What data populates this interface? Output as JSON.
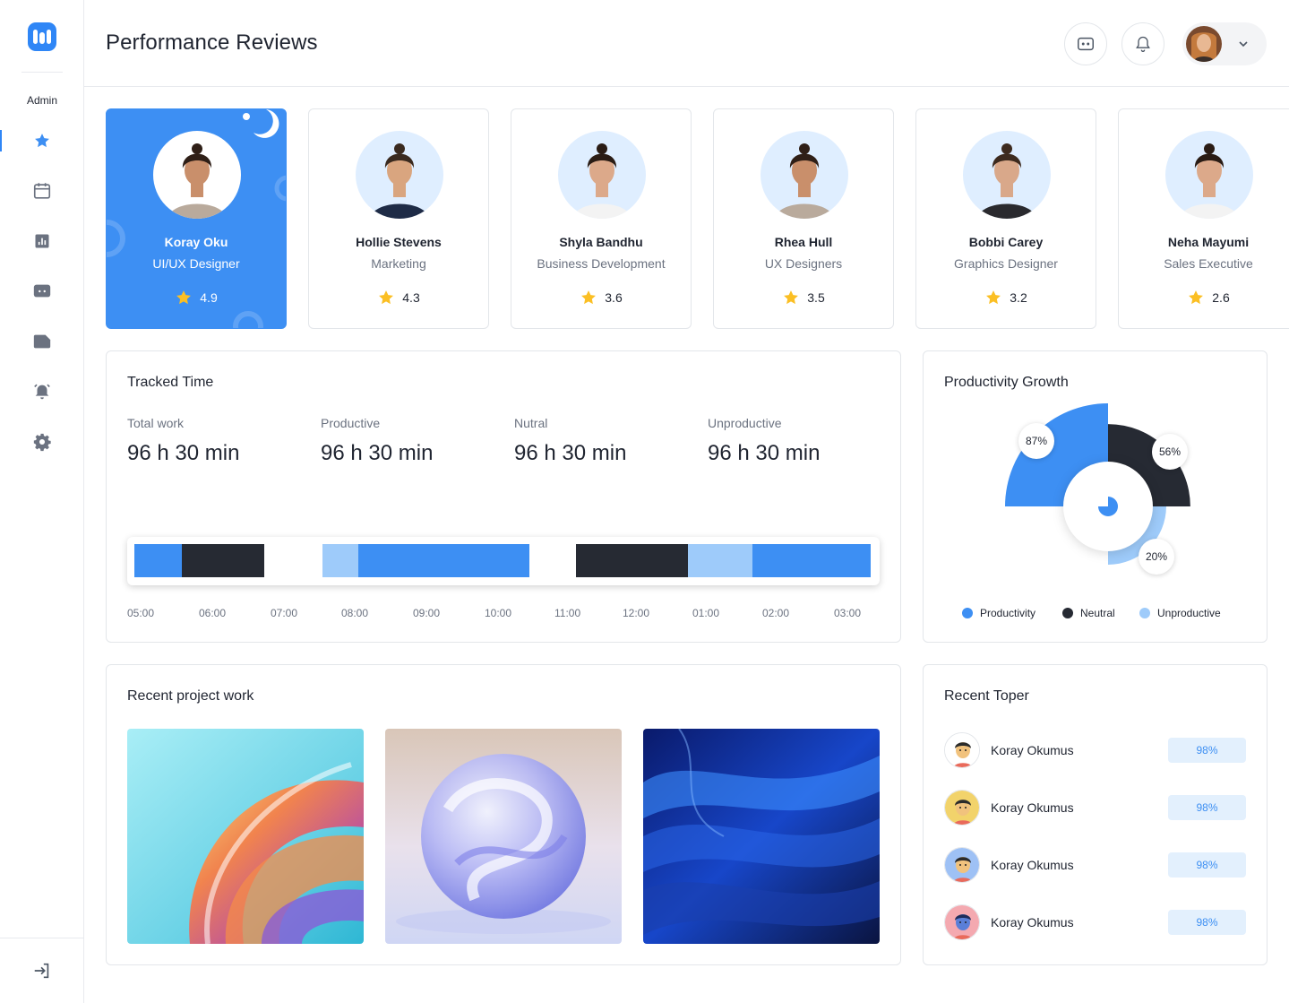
{
  "sidebar": {
    "role_label": "Admin",
    "items": [
      {
        "name": "star-icon",
        "active": true
      },
      {
        "name": "calendar-icon",
        "active": false
      },
      {
        "name": "chart-icon",
        "active": false
      },
      {
        "name": "chat-icon",
        "active": false
      },
      {
        "name": "folder-icon",
        "active": false
      },
      {
        "name": "alarm-icon",
        "active": false
      },
      {
        "name": "settings-icon",
        "active": false
      }
    ],
    "logout_icon": "logout-icon"
  },
  "header": {
    "title": "Performance Reviews",
    "message_icon": "message-icon",
    "bell_icon": "bell-icon",
    "dropdown_icon": "chevron-down-icon"
  },
  "employees": [
    {
      "name": "Koray Oku",
      "role": "UI/UX Designer",
      "rating": "4.9",
      "featured": true
    },
    {
      "name": "Hollie Stevens",
      "role": "Marketing",
      "rating": "4.3",
      "featured": false
    },
    {
      "name": "Shyla Bandhu",
      "role": "Business Development",
      "rating": "3.6",
      "featured": false
    },
    {
      "name": "Rhea Hull",
      "role": "UX Designers",
      "rating": "3.5",
      "featured": false
    },
    {
      "name": "Bobbi Carey",
      "role": "Graphics Designer",
      "rating": "3.2",
      "featured": false
    },
    {
      "name": "Neha Mayumi",
      "role": "Sales Executive",
      "rating": "2.6",
      "featured": false
    }
  ],
  "tracked_time": {
    "title": "Tracked Time",
    "metrics": [
      {
        "label": "Total work",
        "value": "96 h 30 min"
      },
      {
        "label": "Productive",
        "value": "96 h 30 min"
      },
      {
        "label": "Nutral",
        "value": "96 h 30 min"
      },
      {
        "label": "Unproductive",
        "value": "96 h 30 min"
      }
    ],
    "segments": [
      {
        "start": "05:00",
        "end": "05:40",
        "kind": "productive"
      },
      {
        "start": "05:40",
        "end": "06:50",
        "kind": "neutral"
      },
      {
        "start": "07:40",
        "end": "08:10",
        "kind": "unproductive"
      },
      {
        "start": "08:10",
        "end": "10:35",
        "kind": "productive"
      },
      {
        "start": "11:15",
        "end": "12:50",
        "kind": "neutral"
      },
      {
        "start": "12:50",
        "end": "01:45",
        "kind": "unproductive"
      },
      {
        "start": "01:45",
        "end": "03:25",
        "kind": "productive"
      }
    ],
    "ticks": [
      "05:00",
      "06:00",
      "07:00",
      "08:00",
      "09:00",
      "10:00",
      "11:00",
      "12:00",
      "01:00",
      "02:00",
      "03:00"
    ]
  },
  "productivity": {
    "title": "Productivity Growth",
    "chart_data": {
      "type": "pie",
      "categories": [
        "Productivity",
        "Neutral",
        "Unproductive"
      ],
      "values": [
        87,
        56,
        20
      ],
      "labels": [
        "87%",
        "56%",
        "20%"
      ],
      "colors": [
        "#3d8ff3",
        "#262a33",
        "#9ecbfa"
      ],
      "legend": "bottom"
    },
    "center_icon": "pie-chart-icon"
  },
  "projects": {
    "title": "Recent project work",
    "images": [
      "glass-swirl-image",
      "glass-sphere-image",
      "blue-waves-image"
    ]
  },
  "topers": {
    "title": "Recent Toper",
    "items": [
      {
        "name": "Koray Okumus",
        "score": "98%"
      },
      {
        "name": "Koray Okumus",
        "score": "98%"
      },
      {
        "name": "Koray Okumus",
        "score": "98%"
      },
      {
        "name": "Koray Okumus",
        "score": "98%"
      }
    ]
  },
  "colors": {
    "accent": "#3d8ff3",
    "dark": "#262a33",
    "light_blue": "#9ecbfa",
    "star": "#fbbf24"
  }
}
